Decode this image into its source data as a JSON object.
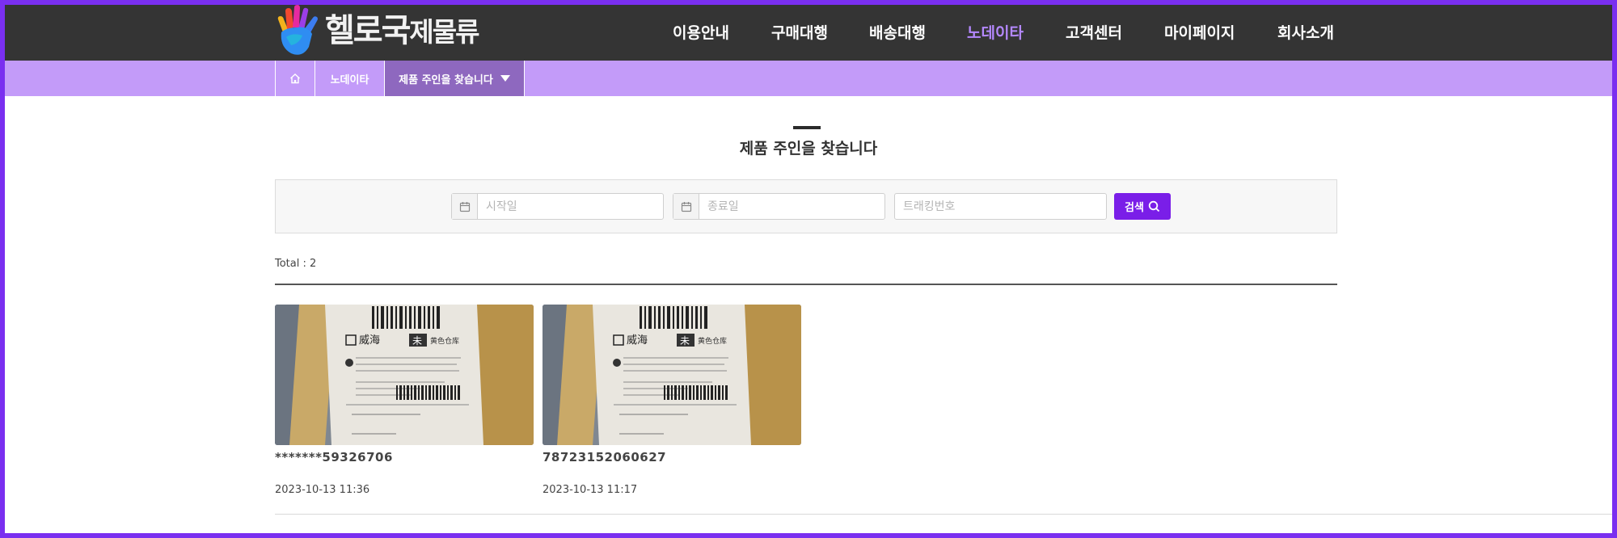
{
  "header": {
    "logo": {
      "main": "헬로국",
      "suffix": "제물류",
      "icon": "hand-logo-icon"
    },
    "nav": [
      {
        "label": "이용안내",
        "active": false
      },
      {
        "label": "구매대행",
        "active": false
      },
      {
        "label": "배송대행",
        "active": false
      },
      {
        "label": "노데이타",
        "active": true
      },
      {
        "label": "고객센터",
        "active": false
      },
      {
        "label": "마이페이지",
        "active": false
      },
      {
        "label": "회사소개",
        "active": false
      }
    ]
  },
  "breadcrumb": {
    "home_icon": "home-icon",
    "items": [
      {
        "label": "노데이타"
      },
      {
        "label": "제품 주인을 찾습니다"
      }
    ]
  },
  "page": {
    "title": "제품 주인을 찾습니다"
  },
  "search": {
    "start_placeholder": "시작일",
    "end_placeholder": "종료일",
    "tracking_placeholder": "트래킹번호",
    "button_label": "검색"
  },
  "results": {
    "total_label": "Total : 2",
    "items": [
      {
        "tracking": "*******59326706",
        "date": "2023-10-13 11:36"
      },
      {
        "tracking": "78723152060627",
        "date": "2023-10-13 11:17"
      }
    ]
  },
  "colors": {
    "accent": "#7a1ee8",
    "nav_active": "#b488ff",
    "breadcrumb_bg": "#c39bf9",
    "header_bg": "#343434"
  }
}
